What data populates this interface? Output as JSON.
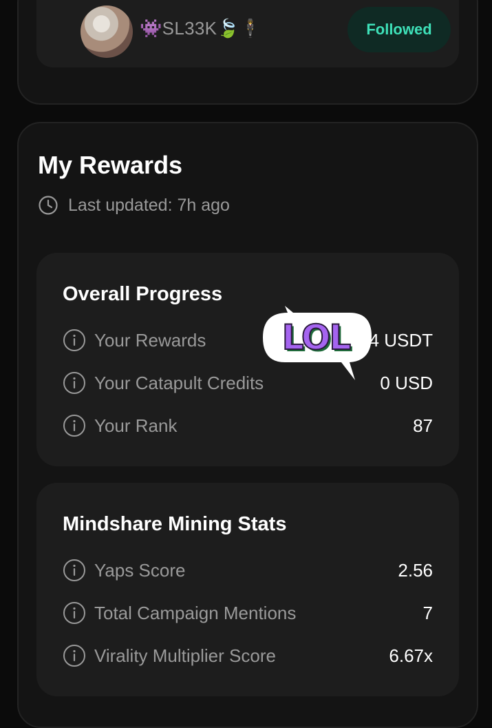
{
  "user": {
    "name": "👾SL33K🍃🕴",
    "follow_label": "Followed"
  },
  "rewards": {
    "title": "My Rewards",
    "last_updated": "Last updated: 7h ago"
  },
  "overall_progress": {
    "title": "Overall Progress",
    "rows": [
      {
        "label": "Your Rewards",
        "value": "4 USDT"
      },
      {
        "label": "Your Catapult Credits",
        "value": "0 USD"
      },
      {
        "label": "Your Rank",
        "value": "87"
      }
    ]
  },
  "mining_stats": {
    "title": "Mindshare Mining Stats",
    "rows": [
      {
        "label": "Yaps Score",
        "value": "2.56"
      },
      {
        "label": "Total Campaign Mentions",
        "value": "7"
      },
      {
        "label": "Virality Multiplier Score",
        "value": "6.67x"
      }
    ]
  },
  "sticker": {
    "text": "LOL"
  },
  "colors": {
    "background": "#0b0b0b",
    "card": "#141414",
    "inner_card": "#1d1d1d",
    "accent": "#3ee0b8",
    "muted_text": "#9a9a9a"
  }
}
